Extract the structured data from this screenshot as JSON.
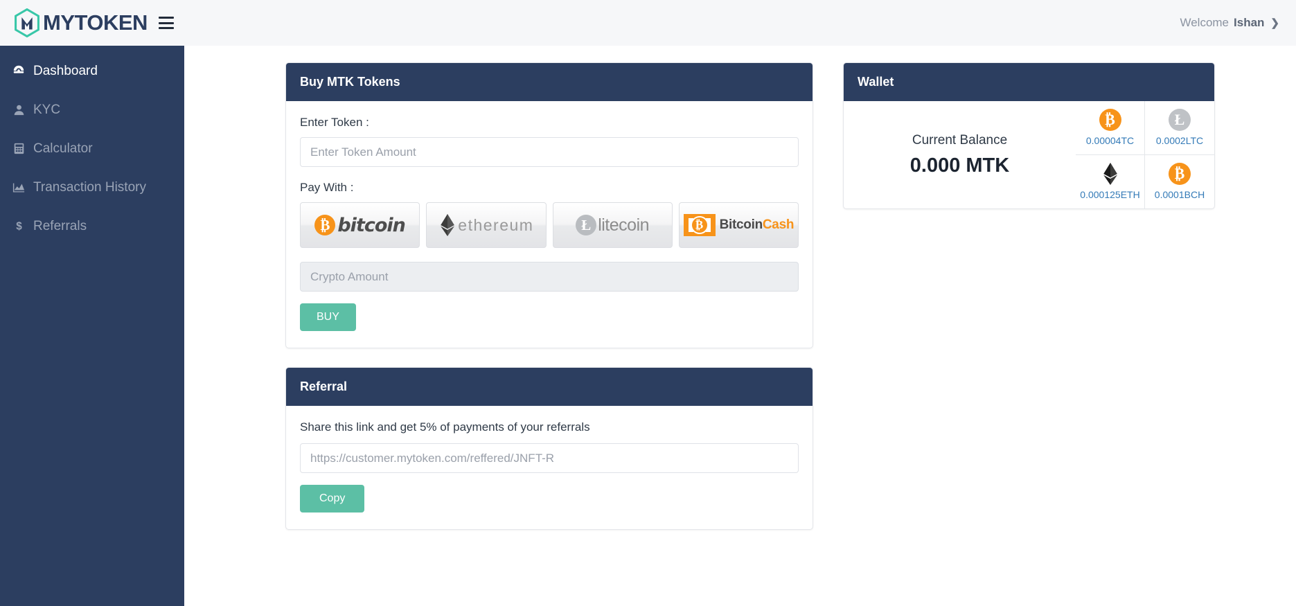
{
  "brand": {
    "name": "MYTOKEN",
    "logo_icon": "hexagon-m-logo-icon",
    "menu_icon": "hamburger-menu-icon"
  },
  "header": {
    "welcome_word": "Welcome",
    "user_name": "Ishan",
    "chevron_icon": "chevron-right-icon"
  },
  "sidebar": {
    "items": [
      {
        "label": "Dashboard",
        "icon": "dashboard-speedometer-icon",
        "active": true
      },
      {
        "label": "KYC",
        "icon": "user-icon",
        "active": false
      },
      {
        "label": "Calculator",
        "icon": "calculator-icon",
        "active": false
      },
      {
        "label": "Transaction History",
        "icon": "chart-area-icon",
        "active": false
      },
      {
        "label": "Referrals",
        "icon": "dollar-sign-icon",
        "active": false
      }
    ]
  },
  "buy_card": {
    "title": "Buy MTK Tokens",
    "token_label": "Enter Token :",
    "token_value": "",
    "token_placeholder": "Enter Token Amount",
    "pay_with_label": "Pay With :",
    "pay_options": [
      {
        "id": "bitcoin",
        "label": "bitcoin",
        "icon": "bitcoin-icon"
      },
      {
        "id": "ethereum",
        "label": "ethereum",
        "icon": "ethereum-icon"
      },
      {
        "id": "litecoin",
        "label": "litecoin",
        "icon": "litecoin-icon"
      },
      {
        "id": "bitcoincash",
        "label_dark": "Bitcoin",
        "label_accent": "Cash",
        "icon": "bitcoin-cash-icon"
      }
    ],
    "crypto_value": "",
    "crypto_placeholder": "Crypto Amount",
    "buy_button": "BUY"
  },
  "referral_card": {
    "title": "Referral",
    "note": "Share this link and get 5% of payments of your referrals",
    "link_value": "",
    "link_placeholder": "https://customer.mytoken.com/reffered/JNFT-R",
    "copy_button": "Copy"
  },
  "wallet_card": {
    "title": "Wallet",
    "balance_label": "Current Balance",
    "balance_value": "0.000 MTK",
    "holdings": [
      {
        "amount": "0.00004TC",
        "icon": "bitcoin-coin-icon"
      },
      {
        "amount": "0.0002LTC",
        "icon": "litecoin-coin-icon"
      },
      {
        "amount": "0.000125ETH",
        "icon": "ethereum-coin-icon"
      },
      {
        "amount": "0.0001BCH",
        "icon": "bitcoin-cash-coin-icon"
      }
    ]
  },
  "colors": {
    "sidebar": "#2c3e60",
    "header_bar": "#f6f7f9",
    "brand_teal": "#38c7a8",
    "accent_green": "#5cbfa5",
    "bitcoin_orange": "#f7931a",
    "link_blue": "#337ab7"
  }
}
